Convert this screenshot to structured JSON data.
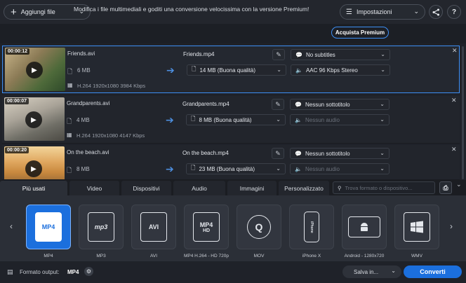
{
  "toolbar": {
    "add_files_label": "Aggiungi file",
    "settings_label": "Impostazioni",
    "share_icon": "share-icon",
    "help_label": "?"
  },
  "promo": {
    "text": "Modifica i file multimediali e goditi una conversione velocissima con la versione Premium!",
    "button_label": "Acquista Premium"
  },
  "files": [
    {
      "time": "00:00:12",
      "name": "Friends.avi",
      "size": "6 MB",
      "codec": "H.264 1920x1080 3984 Kbps",
      "output_name": "Friends.mp4",
      "output_size": "14 MB (Buona qualità)",
      "subtitle": "No subtitles",
      "audio": "AAC 96 Kbps Stereo",
      "audio_enabled": true,
      "selected": true
    },
    {
      "time": "00:00:07",
      "name": "Grandparents.avi",
      "size": "4 MB",
      "codec": "H.264 1920x1080 4147 Kbps",
      "output_name": "Grandparents.mp4",
      "output_size": "8 MB (Buona qualità)",
      "subtitle": "Nessun sottotitolo",
      "audio": "Nessun audio",
      "audio_enabled": false,
      "selected": false
    },
    {
      "time": "00:00:20",
      "name": "On the beach.avi",
      "size": "8 MB",
      "codec": "",
      "output_name": "On the beach.mp4",
      "output_size": "23 MB (Buona qualità)",
      "subtitle": "Nessun sottotitolo",
      "audio": "Nessun audio",
      "audio_enabled": false,
      "selected": false
    }
  ],
  "tabs": [
    {
      "label": "Più usati",
      "active": true
    },
    {
      "label": "Video",
      "active": false
    },
    {
      "label": "Dispositivi",
      "active": false
    },
    {
      "label": "Audio",
      "active": false
    },
    {
      "label": "Immagini",
      "active": false
    },
    {
      "label": "Personalizzato",
      "active": false
    }
  ],
  "search": {
    "placeholder": "Trova formato o dispositivo..."
  },
  "formats": [
    {
      "label": "MP4",
      "icon_text": "MP4",
      "active": true
    },
    {
      "label": "MP3",
      "icon_text": "mp3",
      "active": false
    },
    {
      "label": "AVI",
      "icon_text": "AVI",
      "active": false
    },
    {
      "label": "MP4 H.264 - HD 720p",
      "icon_text": "MP4",
      "active": false
    },
    {
      "label": "MOV",
      "icon_text": "Q",
      "active": false
    },
    {
      "label": "iPhone X",
      "icon_text": "iPhone",
      "active": false
    },
    {
      "label": "Android - 1280x720",
      "icon_text": "android",
      "active": false
    },
    {
      "label": "WMV",
      "icon_text": "win",
      "active": false
    }
  ],
  "bottom": {
    "output_format_label": "Formato output:",
    "output_format_value": "MP4",
    "save_label": "Salva in...",
    "convert_label": "Converti"
  },
  "colors": {
    "accent": "#1b6fdd",
    "background": "#1f2229"
  }
}
